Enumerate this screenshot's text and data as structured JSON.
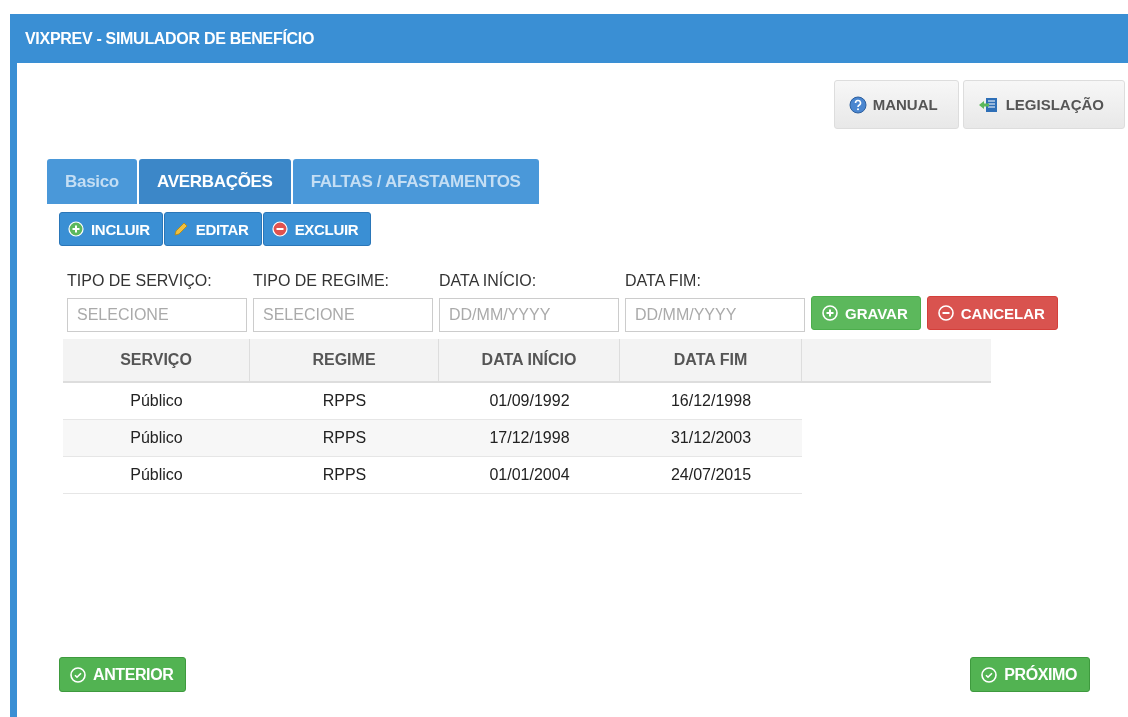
{
  "window": {
    "title": "VIXPREV - SIMULADOR DE BENEFÍCIO"
  },
  "top_buttons": [
    {
      "label": "MANUAL",
      "kind": "help"
    },
    {
      "label": "LEGISLAÇÃO",
      "kind": "law"
    }
  ],
  "tabs": [
    {
      "label": "Basico",
      "selected": false,
      "disabled": true
    },
    {
      "label": "AVERBAÇÕES",
      "selected": true,
      "disabled": false
    },
    {
      "label": "FALTAS / AFASTAMENTOS",
      "selected": false,
      "disabled": true
    }
  ],
  "toolbar": [
    {
      "label": "INCLUIR",
      "kind": "add"
    },
    {
      "label": "EDITAR",
      "kind": "edit"
    },
    {
      "label": "EXCLUIR",
      "kind": "delete"
    }
  ],
  "form": {
    "fields": [
      {
        "label": "TIPO DE SERVIÇO:",
        "placeholder": "SELECIONE"
      },
      {
        "label": "TIPO DE REGIME:",
        "placeholder": "SELECIONE"
      },
      {
        "label": "DATA INÍCIO:",
        "placeholder": "DD/MM/YYYY"
      },
      {
        "label": "DATA FIM:",
        "placeholder": "DD/MM/YYYY"
      }
    ],
    "buttons": [
      {
        "label": "GRAVAR",
        "kind": "save"
      },
      {
        "label": "CANCELAR",
        "kind": "cancel"
      }
    ]
  },
  "table": {
    "columns": [
      "SERVIÇO",
      "REGIME",
      "DATA INÍCIO",
      "DATA FIM"
    ],
    "rows": [
      [
        "Público",
        "RPPS",
        "01/09/1992",
        "16/12/1998"
      ],
      [
        "Público",
        "RPPS",
        "17/12/1998",
        "31/12/2003"
      ],
      [
        "Público",
        "RPPS",
        "01/01/2004",
        "24/07/2015"
      ]
    ]
  },
  "footer": {
    "previous": "ANTERIOR",
    "next": "PRÓXIMO"
  }
}
